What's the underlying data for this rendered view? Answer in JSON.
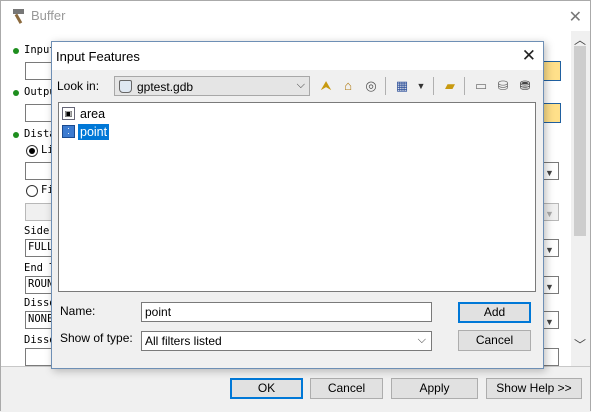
{
  "buffer_window": {
    "title": "Buffer",
    "params": {
      "input_label": "Input",
      "output_label": "Outpu",
      "distance_label": "Dista",
      "linear_label": "Li",
      "field_label": "Fi",
      "side_label": "Side",
      "side_value": "FULL",
      "end_label": "End T",
      "end_value": "ROUN",
      "dissolve_label": "Disso",
      "dissolve_value": "NONE",
      "dissolve2_label": "Disso"
    },
    "footer": {
      "ok_label": "OK",
      "cancel_label": "Cancel",
      "apply_label": "Apply",
      "help_label": "Show Help >>"
    }
  },
  "dialog": {
    "title": "Input Features",
    "look_in_label": "Look in:",
    "look_in_value": "gptest.gdb",
    "files": [
      {
        "name": "area",
        "selected": false,
        "icon": "polygon-feature-class-icon"
      },
      {
        "name": "point",
        "selected": true,
        "icon": "point-feature-class-icon"
      }
    ],
    "name_label": "Name:",
    "name_value": "point",
    "type_label": "Show of type:",
    "type_value": "All filters listed",
    "add_label": "Add",
    "cancel_label": "Cancel"
  }
}
